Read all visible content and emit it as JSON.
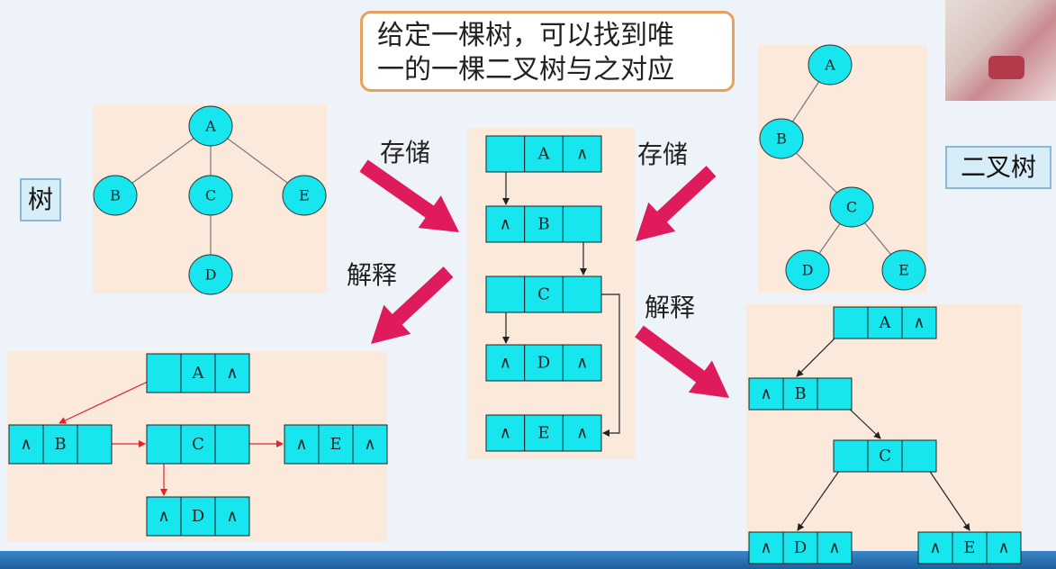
{
  "callout": {
    "line1": "给定一棵树，可以找到唯",
    "line2": "一的一棵二叉树与之对应"
  },
  "labels": {
    "tree": "树",
    "binary_tree": "二叉树"
  },
  "operations": {
    "store_left": "存储",
    "store_right": "存储",
    "interpret_left": "解释",
    "interpret_right": "解释"
  },
  "null_symbol": "∧",
  "tree": {
    "nodes": [
      "A",
      "B",
      "C",
      "D",
      "E"
    ],
    "edges": [
      [
        "A",
        "B"
      ],
      [
        "A",
        "C"
      ],
      [
        "A",
        "E"
      ],
      [
        "C",
        "D"
      ]
    ]
  },
  "binary_tree": {
    "nodes": [
      "A",
      "B",
      "C",
      "D",
      "E"
    ],
    "edges": [
      [
        "A",
        "B"
      ],
      [
        "B",
        "C"
      ],
      [
        "C",
        "D"
      ],
      [
        "C",
        "E"
      ]
    ]
  },
  "linked_storage": {
    "rows": [
      [
        "",
        "A",
        "∧"
      ],
      [
        "∧",
        "B",
        ""
      ],
      [
        "",
        "C",
        ""
      ],
      [
        "∧",
        "D",
        "∧"
      ],
      [
        "∧",
        "E",
        "∧"
      ]
    ]
  },
  "tree_interpretation": {
    "nodes": [
      {
        "id": "A",
        "cells": [
          "",
          "A",
          "∧"
        ]
      },
      {
        "id": "B",
        "cells": [
          "∧",
          "B",
          ""
        ]
      },
      {
        "id": "C",
        "cells": [
          "",
          "C",
          ""
        ]
      },
      {
        "id": "E",
        "cells": [
          "∧",
          "E",
          "∧"
        ]
      },
      {
        "id": "D",
        "cells": [
          "∧",
          "D",
          "∧"
        ]
      }
    ]
  },
  "binary_interpretation": {
    "nodes": [
      {
        "id": "A",
        "cells": [
          "",
          "A",
          "∧"
        ]
      },
      {
        "id": "B",
        "cells": [
          "∧",
          "B",
          ""
        ]
      },
      {
        "id": "C",
        "cells": [
          "",
          "C",
          ""
        ]
      },
      {
        "id": "D",
        "cells": [
          "∧",
          "D",
          "∧"
        ]
      },
      {
        "id": "E",
        "cells": [
          "∧",
          "E",
          "∧"
        ]
      }
    ]
  },
  "colors": {
    "node_fill": "#17e6ef",
    "arrow_big": "#e01b5b",
    "panel": "#fbe9dc",
    "red_link": "#e8202a"
  }
}
